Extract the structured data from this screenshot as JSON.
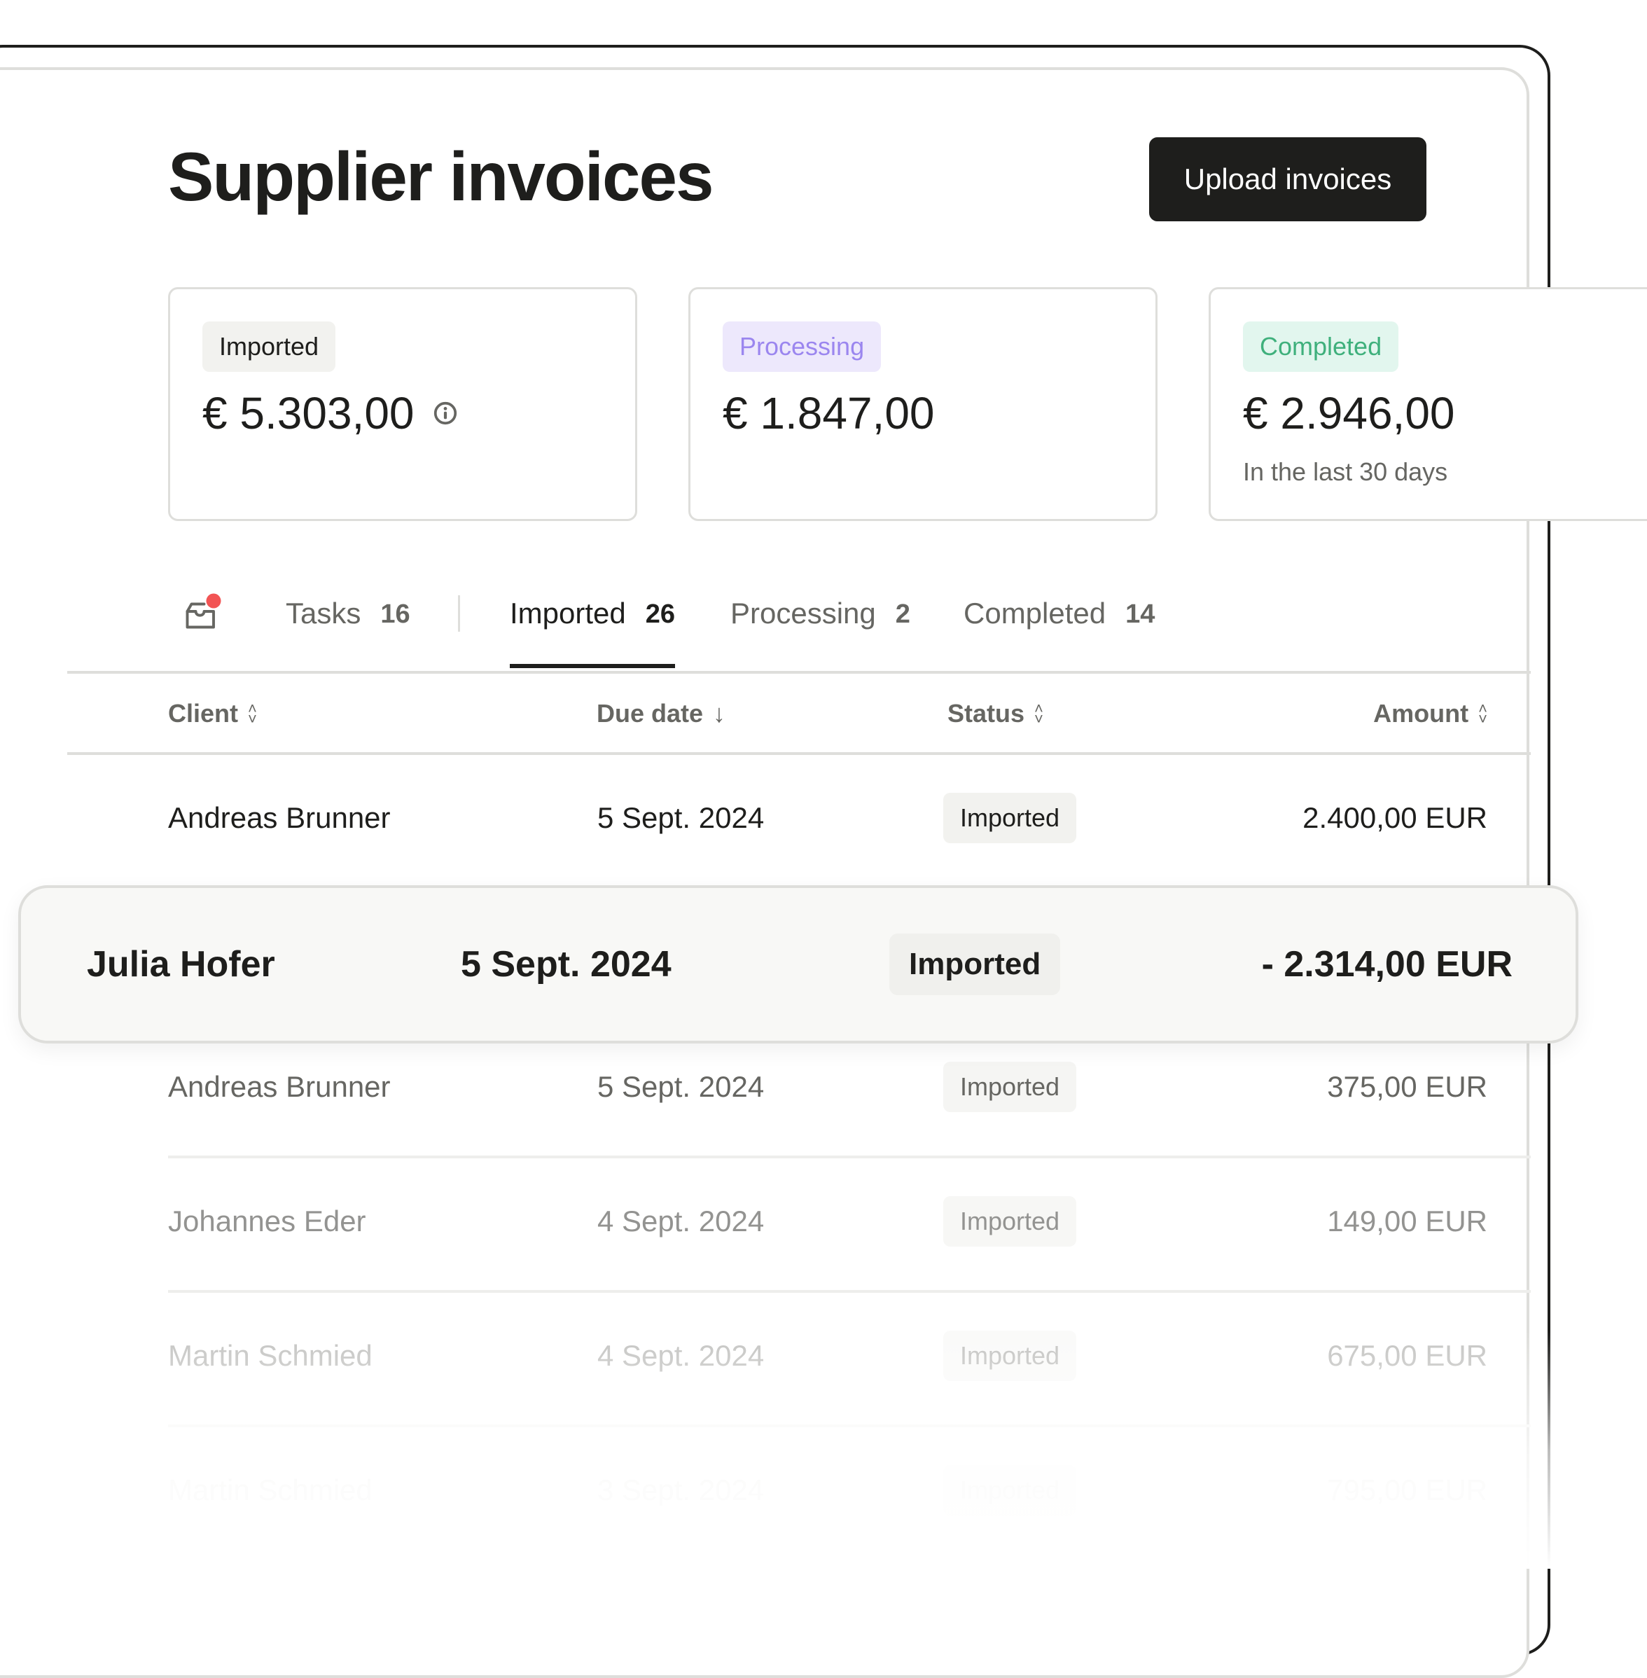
{
  "header": {
    "title": "Supplier invoices",
    "upload_label": "Upload invoices"
  },
  "summary_cards": [
    {
      "badge": "Imported",
      "amount": "€ 5.303,00",
      "icon": "info-icon",
      "subtitle": ""
    },
    {
      "badge": "Processing",
      "amount": "€ 1.847,00",
      "subtitle": ""
    },
    {
      "badge": "Completed",
      "amount": "€ 2.946,00",
      "subtitle": "In the last 30 days"
    }
  ],
  "colors": {
    "primary": "#1e1e1c",
    "processing_text": "#9b86ef",
    "processing_bg": "#ede8fc",
    "completed_text": "#3fb07c",
    "completed_bg": "#e2f6ee",
    "notification_dot": "#f25454"
  },
  "tabs": [
    {
      "label": "Tasks",
      "count": "16",
      "active": false
    },
    {
      "label": "Imported",
      "count": "26",
      "active": true
    },
    {
      "label": "Processing",
      "count": "2",
      "active": false
    },
    {
      "label": "Completed",
      "count": "14",
      "active": false
    }
  ],
  "table": {
    "columns": [
      {
        "label": "Client",
        "sort": "sortable"
      },
      {
        "label": "Due date",
        "sort": "descending"
      },
      {
        "label": "Status",
        "sort": "sortable"
      },
      {
        "label": "Amount",
        "sort": "sortable"
      }
    ],
    "sort_icons": {
      "sortable": "⌃⌄",
      "descending": "↓"
    },
    "rows": [
      {
        "client": "Andreas Brunner",
        "due_date": "5 Sept. 2024",
        "status": "Imported",
        "amount": "2.400,00 EUR"
      },
      {
        "client": "Julia Hofer",
        "due_date": "5 Sept. 2024",
        "status": "Imported",
        "amount": "- 2.314,00 EUR",
        "highlighted": true
      },
      {
        "client": "Andreas Brunner",
        "due_date": "5 Sept. 2024",
        "status": "Imported",
        "amount": "375,00 EUR"
      },
      {
        "client": "Johannes Eder",
        "due_date": "4 Sept. 2024",
        "status": "Imported",
        "amount": "149,00 EUR"
      },
      {
        "client": "Martin Schmied",
        "due_date": "4 Sept. 2024",
        "status": "Imported",
        "amount": "675,00 EUR"
      },
      {
        "client": "Martin Schmied",
        "due_date": "3 Sept. 2024",
        "status": "Imported",
        "amount": "795,00 EUR"
      }
    ]
  }
}
